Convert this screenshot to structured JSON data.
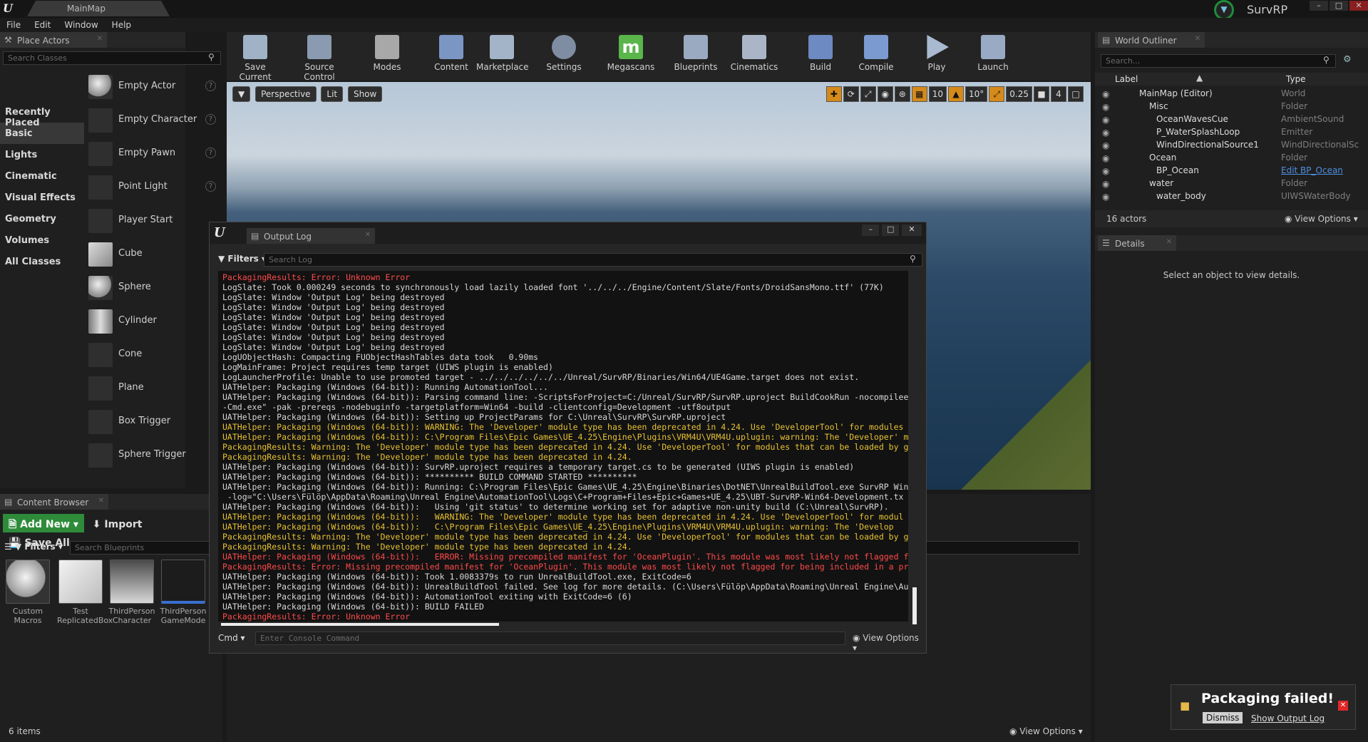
{
  "title_bar": {
    "tab": "MainMap",
    "project": "SurvRP"
  },
  "menu": [
    "File",
    "Edit",
    "Window",
    "Help"
  ],
  "place_actors": {
    "tab": "Place Actors",
    "search_placeholder": "Search Classes",
    "categories": [
      "Recently Placed",
      "Basic",
      "Lights",
      "Cinematic",
      "Visual Effects",
      "Geometry",
      "Volumes",
      "All Classes"
    ],
    "selected_category": "Basic",
    "items": [
      "Empty Actor",
      "Empty Character",
      "Empty Pawn",
      "Point Light",
      "Player Start",
      "Cube",
      "Sphere",
      "Cylinder",
      "Cone",
      "Plane",
      "Box Trigger",
      "Sphere Trigger"
    ],
    "help": "?"
  },
  "toolbar": [
    "Save Current",
    "Source Control",
    "Modes",
    "Content",
    "Marketplace",
    "Settings",
    "Megascans",
    "Blueprints",
    "Cinematics",
    "Build",
    "Compile",
    "Play",
    "Launch"
  ],
  "viewport": {
    "perspective": "Perspective",
    "lit": "Lit",
    "show": "Show",
    "grid_snap": "10",
    "rot_snap": "10°",
    "scale_snap": "0.25",
    "cam_speed": "4"
  },
  "world_outliner": {
    "tab": "World Outliner",
    "search_placeholder": "Search...",
    "col_label": "Label",
    "col_type": "Type",
    "rows": [
      {
        "name": "MainMap (Editor)",
        "type": "World",
        "indent": 0
      },
      {
        "name": "Misc",
        "type": "Folder",
        "indent": 1
      },
      {
        "name": "OceanWavesCue",
        "type": "AmbientSound",
        "indent": 2
      },
      {
        "name": "P_WaterSplashLoop",
        "type": "Emitter",
        "indent": 2
      },
      {
        "name": "WindDirectionalSource1",
        "type": "WindDirectionalSc",
        "indent": 2
      },
      {
        "name": "Ocean",
        "type": "Folder",
        "indent": 1
      },
      {
        "name": "BP_Ocean",
        "type": "Edit BP_Ocean",
        "indent": 2
      },
      {
        "name": "water",
        "type": "Folder",
        "indent": 1
      },
      {
        "name": "water_body",
        "type": "UIWSWaterBody",
        "indent": 2
      }
    ],
    "count": "16 actors",
    "view_options": "View Options"
  },
  "details": {
    "tab": "Details",
    "empty": "Select an object to view details."
  },
  "output_log": {
    "tab": "Output Log",
    "filters": "Filters",
    "search_placeholder": "Search Log",
    "lines": [
      {
        "t": "PackagingResults: Error: Unknown Error",
        "c": "e"
      },
      {
        "t": "LogSlate: Took 0.000249 seconds to synchronously load lazily loaded font '../../../Engine/Content/Slate/Fonts/DroidSansMono.ttf' (77K)",
        "c": "n"
      },
      {
        "t": "LogSlate: Window 'Output Log' being destroyed",
        "c": "n"
      },
      {
        "t": "LogSlate: Window 'Output Log' being destroyed",
        "c": "n"
      },
      {
        "t": "LogSlate: Window 'Output Log' being destroyed",
        "c": "n"
      },
      {
        "t": "LogSlate: Window 'Output Log' being destroyed",
        "c": "n"
      },
      {
        "t": "LogSlate: Window 'Output Log' being destroyed",
        "c": "n"
      },
      {
        "t": "LogSlate: Window 'Output Log' being destroyed",
        "c": "n"
      },
      {
        "t": "LogUObjectHash: Compacting FUObjectHashTables data took   0.90ms",
        "c": "n"
      },
      {
        "t": "LogMainFrame: Project requires temp target (UIWS plugin is enabled)",
        "c": "n"
      },
      {
        "t": "LogLauncherProfile: Unable to use promoted target - ../../../../../../Unreal/SurvRP/Binaries/Win64/UE4Game.target does not exist.",
        "c": "n"
      },
      {
        "t": "UATHelper: Packaging (Windows (64-bit)): Running AutomationTool...",
        "c": "n"
      },
      {
        "t": "UATHelper: Packaging (Windows (64-bit)): Parsing command line: -ScriptsForProject=C:/Unreal/SurvRP/SurvRP.uproject BuildCookRun -nocompileeditor",
        "c": "n"
      },
      {
        "t": "-Cmd.exe\" -pak -prereqs -nodebuginfo -targetplatform=Win64 -build -clientconfig=Development -utf8output",
        "c": "n"
      },
      {
        "t": "UATHelper: Packaging (Windows (64-bit)): Setting up ProjectParams for C:\\Unreal\\SurvRP\\SurvRP.uproject",
        "c": "n"
      },
      {
        "t": "UATHelper: Packaging (Windows (64-bit)): WARNING: The 'Developer' module type has been deprecated in 4.24. Use 'DeveloperTool' for modules",
        "c": "w"
      },
      {
        "t": "UATHelper: Packaging (Windows (64-bit)): C:\\Program Files\\Epic Games\\UE_4.25\\Engine\\Plugins\\VRM4U\\VRM4U.uplugin: warning: The 'Developer' m",
        "c": "w"
      },
      {
        "t": "PackagingResults: Warning: The 'Developer' module type has been deprecated in 4.24. Use 'DeveloperTool' for modules that can be loaded by g",
        "c": "w"
      },
      {
        "t": "PackagingResults: Warning: The 'Developer' module type has been deprecated in 4.24.",
        "c": "w"
      },
      {
        "t": "UATHelper: Packaging (Windows (64-bit)): SurvRP.uproject requires a temporary target.cs to be generated (UIWS plugin is enabled)",
        "c": "n"
      },
      {
        "t": "UATHelper: Packaging (Windows (64-bit)): ********** BUILD COMMAND STARTED **********",
        "c": "n"
      },
      {
        "t": "UATHelper: Packaging (Windows (64-bit)): Running: C:\\Program Files\\Epic Games\\UE_4.25\\Engine\\Binaries\\DotNET\\UnrealBuildTool.exe SurvRP Win",
        "c": "n"
      },
      {
        "t": " -log=\"C:\\Users\\Fülöp\\AppData\\Roaming\\Unreal Engine\\AutomationTool\\Logs\\C+Program+Files+Epic+Games+UE_4.25\\UBT-SurvRP-Win64-Development.tx",
        "c": "n"
      },
      {
        "t": "UATHelper: Packaging (Windows (64-bit)):   Using 'git status' to determine working set for adaptive non-unity build (C:\\Unreal\\SurvRP).",
        "c": "n"
      },
      {
        "t": "UATHelper: Packaging (Windows (64-bit)):   WARNING: The 'Developer' module type has been deprecated in 4.24. Use 'DeveloperTool' for modul",
        "c": "w"
      },
      {
        "t": "UATHelper: Packaging (Windows (64-bit)):   C:\\Program Files\\Epic Games\\UE_4.25\\Engine\\Plugins\\VRM4U\\VRM4U.uplugin: warning: The 'Develop",
        "c": "w"
      },
      {
        "t": "PackagingResults: Warning: The 'Developer' module type has been deprecated in 4.24. Use 'DeveloperTool' for modules that can be loaded by g",
        "c": "w"
      },
      {
        "t": "PackagingResults: Warning: The 'Developer' module type has been deprecated in 4.24.",
        "c": "w"
      },
      {
        "t": "UATHelper: Packaging (Windows (64-bit)):   ERROR: Missing precompiled manifest for 'OceanPlugin'. This module was most likely not flagged f",
        "c": "e"
      },
      {
        "t": "PackagingResults: Error: Missing precompiled manifest for 'OceanPlugin'. This module was most likely not flagged for being included in a pr",
        "c": "e"
      },
      {
        "t": "UATHelper: Packaging (Windows (64-bit)): Took 1.0083379s to run UnrealBuildTool.exe, ExitCode=6",
        "c": "n"
      },
      {
        "t": "UATHelper: Packaging (Windows (64-bit)): UnrealBuildTool failed. See log for more details. (C:\\Users\\Fülöp\\AppData\\Roaming\\Unreal Engine\\Au",
        "c": "n"
      },
      {
        "t": "UATHelper: Packaging (Windows (64-bit)): AutomationTool exiting with ExitCode=6 (6)",
        "c": "n"
      },
      {
        "t": "UATHelper: Packaging (Windows (64-bit)): BUILD FAILED",
        "c": "n"
      },
      {
        "t": "PackagingResults: Error: Unknown Error",
        "c": "e"
      }
    ],
    "cmd_label": "Cmd",
    "cmd_placeholder": "Enter Console Command",
    "view_options": "View Options"
  },
  "content_browser": {
    "tab": "Content Browser",
    "add_new": "Add New",
    "import": "Import",
    "save_all": "Save All",
    "filters": "Filters",
    "search_placeholder": "Search Blueprints",
    "assets": [
      {
        "name1": "Custom",
        "name2": "Macros"
      },
      {
        "name1": "Test",
        "name2": "ReplicatedBox"
      },
      {
        "name1": "ThirdPerson",
        "name2": "Character"
      },
      {
        "name1": "ThirdPerson",
        "name2": "GameMode"
      }
    ],
    "count": "6 items",
    "view_options": "View Options"
  },
  "notification": {
    "title": "Packaging failed!",
    "dismiss": "Dismiss",
    "show_log": "Show Output Log"
  },
  "colors": {
    "accent_green": "#1f8d3a",
    "warning": "#e8c233",
    "error": "#ff4a4a",
    "snap_orange": "#d58a1a"
  }
}
